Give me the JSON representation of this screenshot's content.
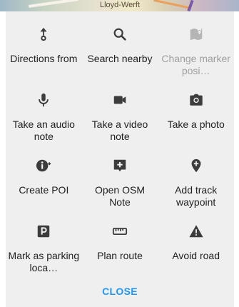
{
  "map": {
    "label": "Lloyd-Werft"
  },
  "menu": {
    "items": [
      {
        "label": "Directions from",
        "icon": "directions-from-icon",
        "disabled": false
      },
      {
        "label": "Search nearby",
        "icon": "search-icon",
        "disabled": false
      },
      {
        "label": "Change marker posi…",
        "icon": "change-marker-position-icon",
        "disabled": true
      },
      {
        "label": "Take an audio note",
        "icon": "microphone-icon",
        "disabled": false
      },
      {
        "label": "Take a video note",
        "icon": "video-camera-icon",
        "disabled": false
      },
      {
        "label": "Take a photo",
        "icon": "photo-camera-icon",
        "disabled": false
      },
      {
        "label": "Create POI",
        "icon": "create-poi-icon",
        "disabled": false
      },
      {
        "label": "Open OSM Note",
        "icon": "osm-note-icon",
        "disabled": false
      },
      {
        "label": "Add track waypoint",
        "icon": "track-waypoint-icon",
        "disabled": false
      },
      {
        "label": "Mark as parking loca…",
        "icon": "parking-icon",
        "disabled": false
      },
      {
        "label": "Plan route",
        "icon": "ruler-icon",
        "disabled": false
      },
      {
        "label": "Avoid road",
        "icon": "warning-icon",
        "disabled": false
      }
    ],
    "close_label": "CLOSE"
  },
  "colors": {
    "icon": "#3c3c3c",
    "icon_disabled": "#b5b5b5",
    "text": "#212121",
    "text_disabled": "#9e9e9e",
    "accent": "#2196f3",
    "sheet_bg": "#efefef"
  }
}
